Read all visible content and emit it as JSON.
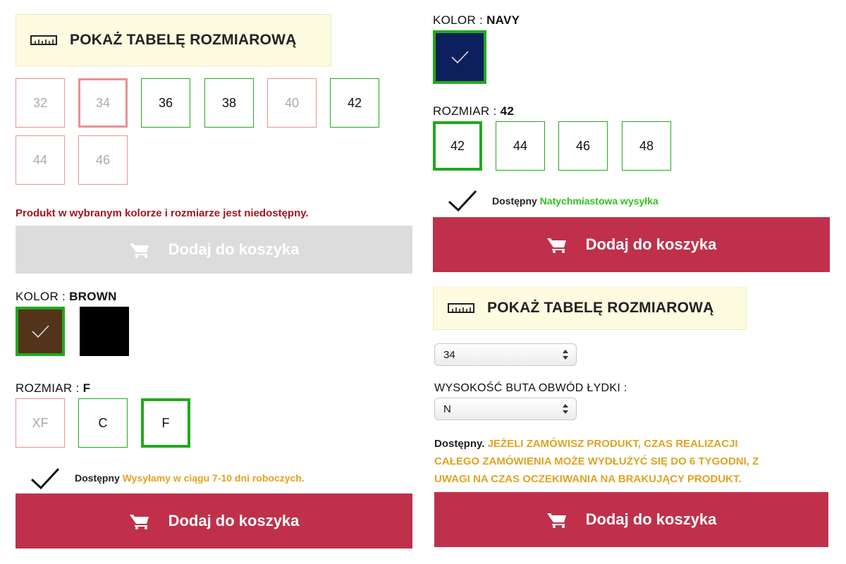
{
  "left": {
    "size_chart_label": "POKAŻ TABELĘ ROZMIAROWĄ",
    "top_sizes": [
      "32",
      "34",
      "36",
      "38",
      "40",
      "42",
      "44",
      "46"
    ],
    "unavailable_message": "Produkt w wybranym kolorze i rozmiarze jest niedostępny.",
    "disabled_cart_label": "Dodaj do koszyka",
    "color_label": "KOLOR :",
    "color_value": "BROWN",
    "swatches": [
      {
        "name": "brown",
        "color": "#53341a"
      },
      {
        "name": "black",
        "color": "#000000"
      }
    ],
    "size_label": "ROZMIAR :",
    "size_value": "F",
    "bottom_sizes": [
      "XF",
      "C",
      "F"
    ],
    "availability": "Dostępny",
    "shipping": "Wysyłamy w ciągu 7-10 dni roboczych.",
    "cart_label": "Dodaj do koszyka"
  },
  "right": {
    "color_label": "KOLOR :",
    "color_value": "NAVY",
    "swatch_color": "#0d1f5c",
    "size_label": "ROZMIAR :",
    "size_value": "42",
    "sizes": [
      "42",
      "44",
      "46",
      "48"
    ],
    "availability": "Dostępny",
    "shipping": "Natychmiastowa wysyłka",
    "cart_label": "Dodaj do koszyka",
    "size_chart_label": "POKAŻ TABELĘ ROZMIAROWĄ",
    "size_select_value": "34",
    "boot_label": "WYSOKOŚĆ BUTA OBWÓD ŁYDKI :",
    "boot_select_value": "N",
    "notice_prefix": "Dostępny.",
    "notice_lines": [
      "JEŻELI ZAMÓWISZ PRODUKT, CZAS REALIZACJI",
      "CAŁEGO ZAMÓWIENIA MOŻE WYDŁUŻYĆ SIĘ DO 6 TYGODNI, Z",
      "UWAGI NA CZAS OCZEKIWANIA NA BRAKUJĄCY PRODUKT."
    ],
    "cart_label_2": "Dodaj do koszyka"
  },
  "colors": {
    "accent_red": "#c0304a",
    "available_green": "#22a81e",
    "unavailable_pink": "#ef8f8f",
    "error_red": "#a5151f",
    "gold": "#e0a322"
  },
  "icons": [
    "ruler-icon",
    "cart-icon",
    "checkmark-icon",
    "select-arrows-icon"
  ]
}
